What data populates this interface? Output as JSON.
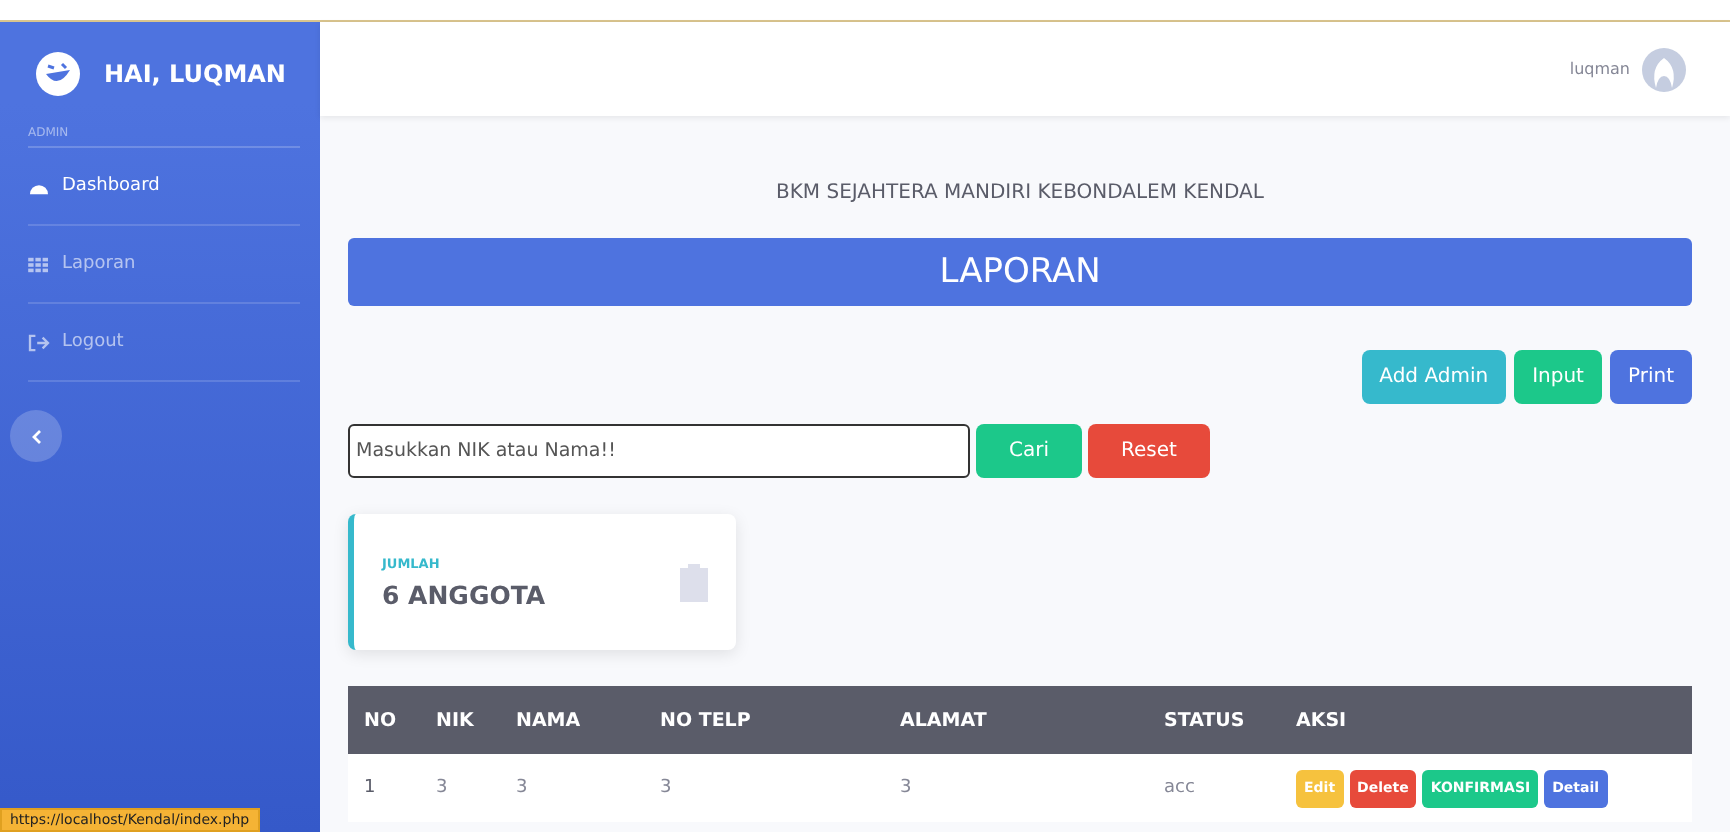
{
  "sidebar": {
    "brand": "HAI, LUQMAN",
    "section": "ADMIN",
    "items": [
      {
        "label": "Dashboard",
        "kind": "dashboard",
        "selected": true
      },
      {
        "label": "Laporan",
        "kind": "report",
        "selected": false
      },
      {
        "label": "Logout",
        "kind": "logout",
        "selected": false
      }
    ]
  },
  "topbar": {
    "user": "luqman"
  },
  "header": {
    "subtitle": "BKM SEJAHTERA MANDIRI KEBONDALEM KENDAL",
    "title": "LAPORAN"
  },
  "actions": [
    {
      "label": "Add Admin",
      "kind": "info"
    },
    {
      "label": "Input",
      "kind": "success"
    },
    {
      "label": "Print",
      "kind": "primary"
    }
  ],
  "search": {
    "placeholder": "Masukkan NIK atau Nama!!",
    "buttons": [
      {
        "label": "Cari",
        "kind": "success"
      },
      {
        "label": "Reset",
        "kind": "danger"
      }
    ]
  },
  "card": {
    "label": "JUMLAH",
    "value": "6 ANGGOTA"
  },
  "table": {
    "columns": [
      "NO",
      "NIK",
      "NAMA",
      "NO TELP",
      "ALAMAT",
      "STATUS",
      "AKSI"
    ],
    "rows": [
      {
        "cells": [
          "1",
          "3",
          "3",
          "3",
          "3",
          "acc"
        ],
        "actions": [
          {
            "label": "Edit",
            "kind": "warning"
          },
          {
            "label": "Delete",
            "kind": "danger"
          },
          {
            "label": "KONFIRMASI",
            "kind": "success"
          },
          {
            "label": "Detail",
            "kind": "primary"
          }
        ]
      }
    ]
  },
  "status_bar": {
    "url": "https://localhost/Kendal/index.php"
  }
}
